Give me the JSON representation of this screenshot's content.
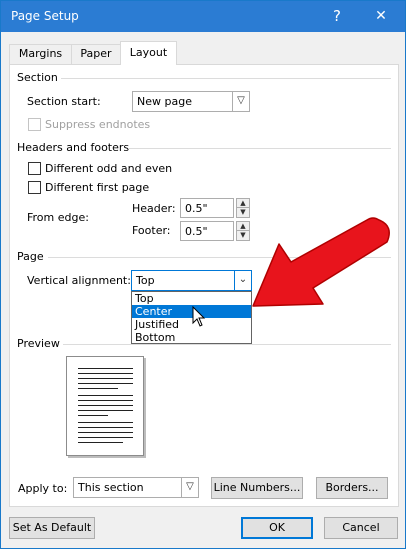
{
  "window": {
    "title": "Page Setup",
    "help": "?",
    "close": "✕"
  },
  "tabs": [
    {
      "label": "Margins"
    },
    {
      "label": "Paper"
    },
    {
      "label": "Layout"
    }
  ],
  "section": {
    "heading": "Section",
    "start_label": "Section start:",
    "start_value": "New page",
    "suppress_label": "Suppress endnotes"
  },
  "headers": {
    "heading": "Headers and footers",
    "odd_even_label": "Different odd and even",
    "first_page_label": "Different first page",
    "from_edge_label": "From edge:",
    "header_label": "Header:",
    "header_value": "0.5\"",
    "footer_label": "Footer:",
    "footer_value": "0.5\""
  },
  "page": {
    "heading": "Page",
    "valign_label": "Vertical alignment:",
    "valign_value": "Top",
    "options": [
      "Top",
      "Center",
      "Justified",
      "Bottom"
    ],
    "highlighted_option": "Center"
  },
  "preview": {
    "heading": "Preview"
  },
  "apply": {
    "label": "Apply to:",
    "value": "This section",
    "line_numbers": "Line Numbers...",
    "borders": "Borders..."
  },
  "footer": {
    "default": "Set As Default",
    "ok": "OK",
    "cancel": "Cancel"
  },
  "colors": {
    "accent": "#0078d7",
    "titlebar": "#2b7cd3",
    "arrow": "#e8141c"
  }
}
